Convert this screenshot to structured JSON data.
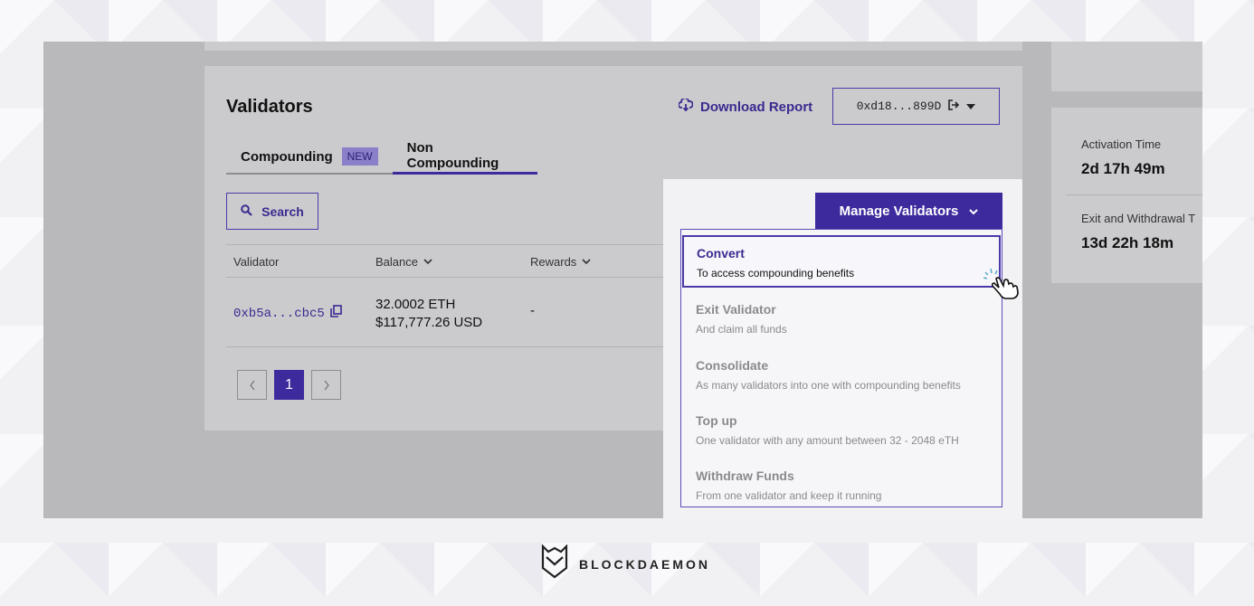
{
  "card": {
    "title": "Validators",
    "download_label": "Download Report",
    "address": "0xd18...899D"
  },
  "tabs": [
    {
      "label": "Compounding",
      "badge": "NEW"
    },
    {
      "label": "Non Compounding"
    }
  ],
  "search": {
    "label": "Search"
  },
  "table": {
    "headers": [
      "Validator",
      "Balance",
      "Rewards"
    ],
    "rows": [
      {
        "validator": "0xb5a...cbc5",
        "balance_eth": "32.0002 ETH",
        "balance_usd": "$117,777.26 USD",
        "rewards": "-"
      }
    ]
  },
  "pagination": {
    "current": "1"
  },
  "stats": {
    "activation_label": "Activation Time",
    "activation_value": "2d 17h 49m",
    "exit_label": "Exit and Withdrawal T",
    "exit_value": "13d 22h 18m"
  },
  "manage": {
    "label": "Manage Validators",
    "items": [
      {
        "title": "Convert",
        "subtitle": "To access compounding benefits"
      },
      {
        "title": "Exit Validator",
        "subtitle": "And claim all funds"
      },
      {
        "title": "Consolidate",
        "subtitle": "As many validators into one with compounding benefits"
      },
      {
        "title": "Top up",
        "subtitle": "One validator with any amount between 32 - 2048 eTH"
      },
      {
        "title": "Withdraw Funds",
        "subtitle": "From one validator and keep it running"
      }
    ]
  },
  "brand": {
    "name": "BLOCKDAEMON"
  },
  "colors": {
    "accent": "#3d2b9e",
    "overlay": "#b9b9bc"
  },
  "icons": [
    "cloud-download-icon",
    "logout-icon",
    "chevron-down-icon",
    "search-icon",
    "copy-icon",
    "pointer-hand-icon",
    "blockdaemon-logo-icon"
  ]
}
